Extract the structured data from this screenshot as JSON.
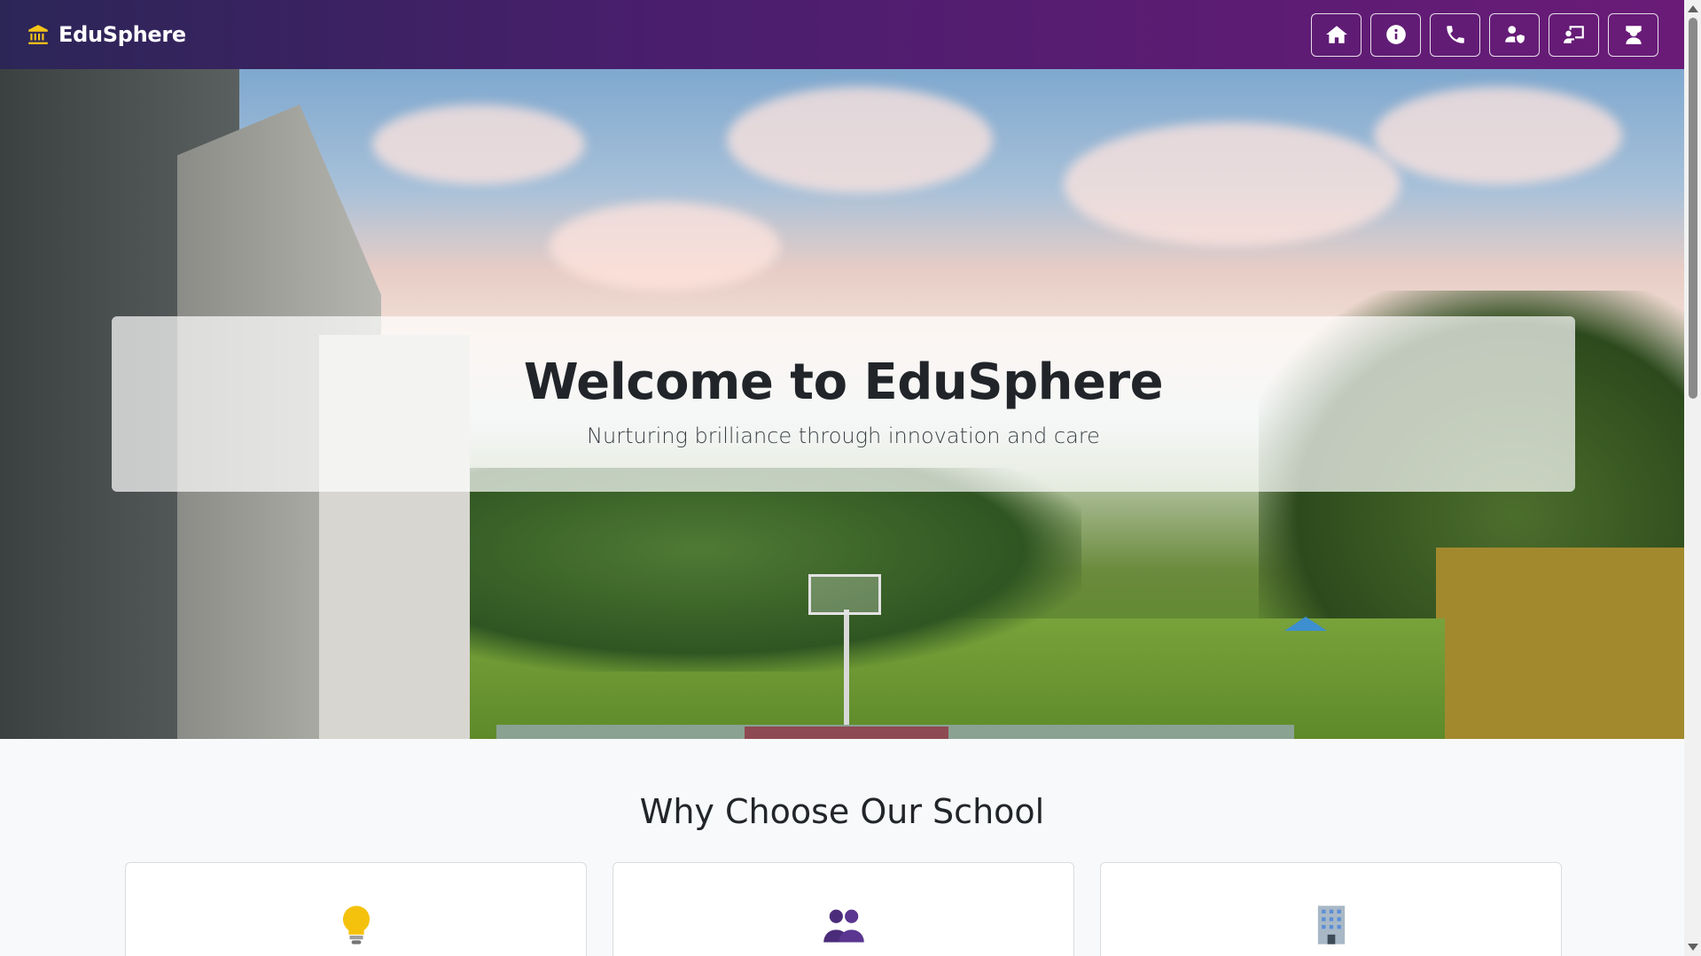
{
  "navbar": {
    "brand_icon": "bank-icon",
    "brand_name": "EduSphere",
    "buttons": [
      {
        "icon": "home-icon"
      },
      {
        "icon": "info-icon"
      },
      {
        "icon": "phone-icon"
      },
      {
        "icon": "user-shield-icon"
      },
      {
        "icon": "chalkboard-teacher-icon"
      },
      {
        "icon": "graduate-icon"
      }
    ],
    "gradient": [
      "#2c2657",
      "#6a1b78"
    ]
  },
  "hero": {
    "title": "Welcome to EduSphere",
    "subtitle": "Nurturing brilliance through innovation and care"
  },
  "features": {
    "title": "Why Choose Our School",
    "cards": [
      {
        "icon": "lightbulb-icon"
      },
      {
        "icon": "people-icon"
      },
      {
        "icon": "building-icon"
      }
    ]
  }
}
